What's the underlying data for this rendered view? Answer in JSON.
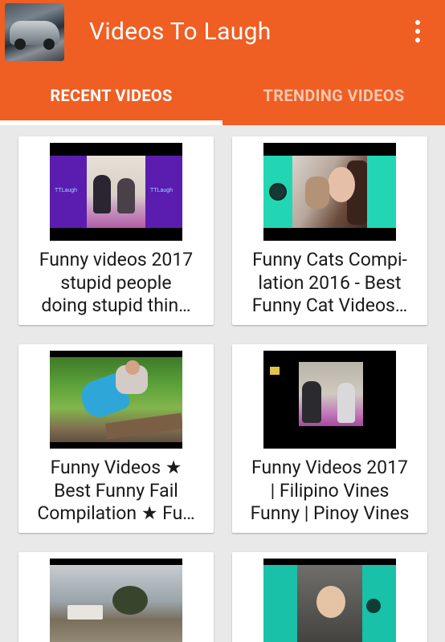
{
  "app": {
    "title": "Videos To Laugh",
    "icons": {
      "app_thumbnail": "app-thumbnail-image",
      "overflow": "more-vert-icon"
    },
    "colors": {
      "primary": "#ef5e23",
      "tab_active": "#ffffff",
      "tab_inactive": "#f8c7ae",
      "background": "#e9e9e9"
    }
  },
  "tabs": [
    {
      "label": "RECENT VIDEOS",
      "active": true
    },
    {
      "label": "TRENDING VIDEOS",
      "active": false
    }
  ],
  "videos": [
    {
      "title": "Funny videos 2017\nstupid people\ndoing stupid thin…"
    },
    {
      "title": "Funny Cats Compi-\nlation 2016  - Best\nFunny Cat Videos…"
    },
    {
      "title": "Funny Videos ★\nBest Funny Fail\nCompilation ★ Fu…"
    },
    {
      "title": "Funny Videos 2017\n| Filipino Vines\nFunny | Pinoy Vines"
    },
    {
      "title": ""
    },
    {
      "title": ""
    }
  ]
}
